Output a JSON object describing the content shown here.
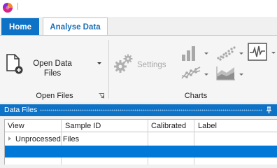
{
  "tabs": [
    {
      "label": "Home",
      "active": false
    },
    {
      "label": "Analyse Data",
      "active": true
    }
  ],
  "ribbon": {
    "open_files": {
      "button_label_line1": "Open Data",
      "button_label_line2": "Files",
      "group_label": "Open Files"
    },
    "charts": {
      "settings_label": "Settings",
      "settings_enabled": false,
      "group_label": "Charts",
      "buttons": [
        {
          "name": "bar-chart",
          "has_dropdown": true
        },
        {
          "name": "scatter-chart",
          "has_dropdown": true
        },
        {
          "name": "waveform-chart",
          "has_dropdown": true
        },
        {
          "name": "line-chart",
          "has_dropdown": true
        },
        {
          "name": "area-chart",
          "has_dropdown": true
        }
      ]
    }
  },
  "data_files_panel": {
    "title": "Data Files",
    "columns": [
      "View",
      "Sample ID",
      "Calibrated",
      "Label"
    ],
    "groups": [
      {
        "label": "Unprocessed Files",
        "expanded": false
      }
    ],
    "selected_row_color": "#0078d7"
  },
  "colors": {
    "accent": "#0e73c6",
    "active_tab_text": "#1c6fb6",
    "disabled_text": "#a8a8a8"
  }
}
